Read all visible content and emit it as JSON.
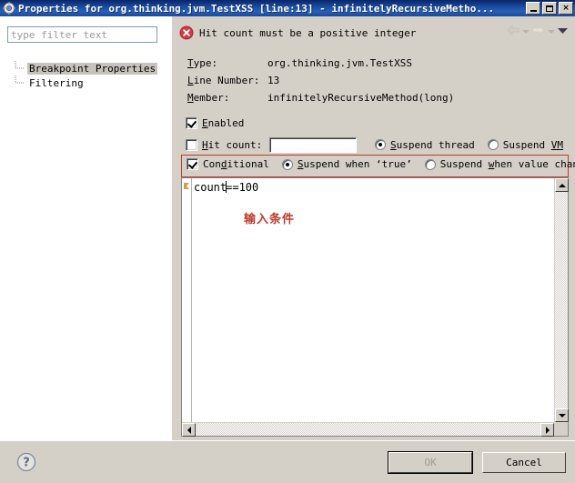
{
  "window": {
    "title": "Properties for org.thinking.jvm.TestXSS [line:13] - infinitelyRecursiveMetho...",
    "icon": "properties-gear-icon",
    "controls": {
      "minimize": "minimize-button",
      "maximize": "maximize-button",
      "close": "close-button",
      "close_glyph": "×"
    }
  },
  "sidebar": {
    "filter": {
      "value": "",
      "placeholder": "type filter text"
    },
    "items": [
      {
        "label": "Breakpoint Properties",
        "selected": true
      },
      {
        "label": "Filtering",
        "selected": false
      }
    ]
  },
  "message": {
    "icon": "error-icon",
    "text": "Hit count must be a positive integer",
    "color": "#c0392b",
    "nav": {
      "back": "back-arrow-icon",
      "back_menu": "back-dropdown-icon",
      "forward": "forward-arrow-icon",
      "forward_menu": "forward-dropdown-icon",
      "menu": "view-menu-chevron-icon"
    }
  },
  "details": [
    {
      "key_prefix": "T",
      "key_rest": "ype:",
      "value": "org.thinking.jvm.TestXSS"
    },
    {
      "key_prefix": "L",
      "key_rest": "ine Number:",
      "value": "13"
    },
    {
      "key_prefix": "M",
      "key_rest": "ember:",
      "value": "infinitelyRecursiveMethod(long)"
    }
  ],
  "options": {
    "enabled": {
      "label_pre": "E",
      "label_post": "nabled",
      "checked": true
    },
    "hit_count": {
      "label_pre": "H",
      "label_post": "it count:",
      "checked": false,
      "value": "",
      "placeholder": ""
    },
    "suspend_thread": {
      "label_pre": "S",
      "label_post": "uspend thread",
      "selected": true
    },
    "suspend_vm": {
      "label_pre": "Suspend ",
      "label_post": "VM",
      "selected": false
    },
    "conditional": {
      "label_pre": "Con",
      "label_mid": "d",
      "label_post": "itional",
      "checked": true,
      "highlight_color": "#c0392b"
    },
    "suspend_when_true": {
      "label_pre": "S",
      "label_post": "uspend when ‘true’",
      "selected": true
    },
    "suspend_when_change": {
      "label_pre": "Suspend ",
      "label_mid": "w",
      "label_post": "hen value changes",
      "selected": false
    }
  },
  "editor": {
    "text_before_caret": "count",
    "text_after_caret": "==100",
    "annotation": "输入条件",
    "annotation_color": "#c0392b",
    "gutter_marker": "breakpoint-marker-icon",
    "vscroll": {
      "up": "scroll-up-icon",
      "down": "scroll-down-icon"
    },
    "hscroll": {
      "left": "scroll-left-icon",
      "right": "scroll-right-icon"
    }
  },
  "footer": {
    "help": "help-icon",
    "help_glyph": "?",
    "ok_label": "OK",
    "ok_enabled": false,
    "cancel_label": "Cancel"
  }
}
